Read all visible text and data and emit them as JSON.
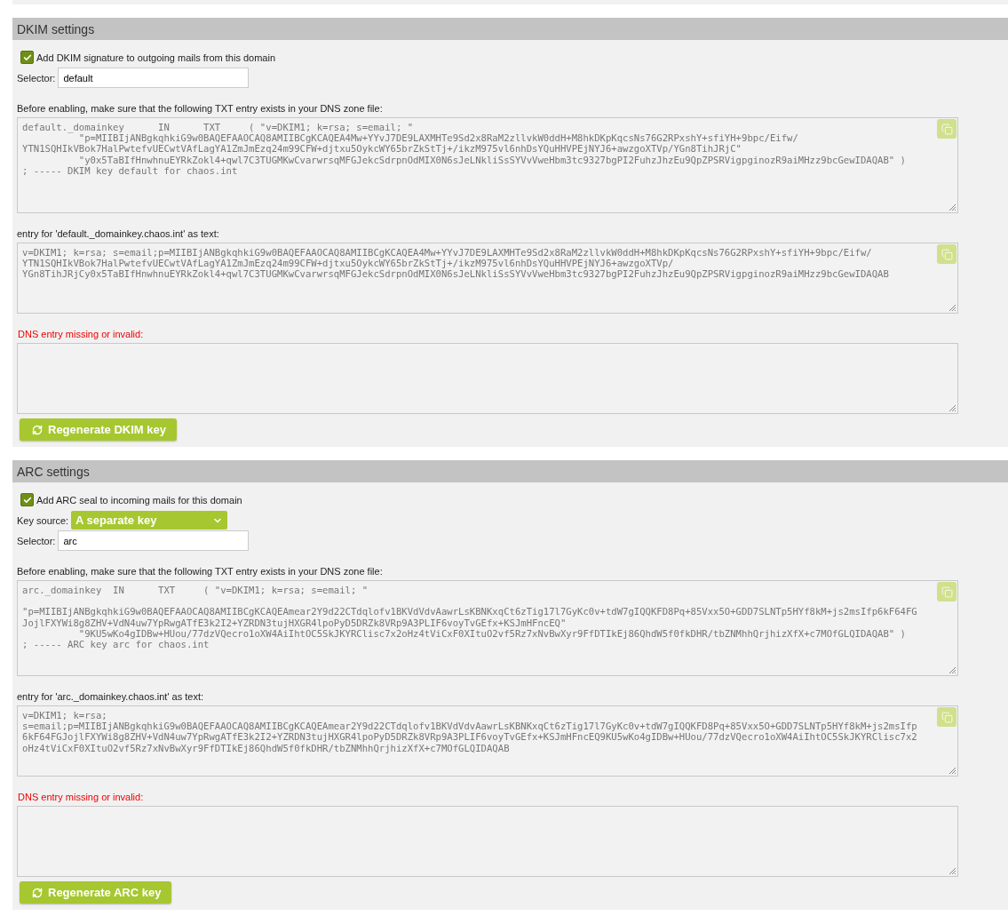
{
  "sections": [
    {
      "title": "DKIM settings",
      "fields": [
        {
          "kind": "checkbox",
          "label": "Add DKIM signature to outgoing mails from this domain",
          "checked": true
        },
        {
          "kind": "text",
          "label": "Selector:",
          "value": "default"
        }
      ],
      "blocks": [
        {
          "kind": "record",
          "label": "Before enabling, make sure that the following TXT entry exists in your DNS zone file:",
          "copy_button": true,
          "text": "default._domainkey      IN      TXT     ( \"v=DKIM1; k=rsa; s=email; \"\n          \"p=MIIBIjANBgkqhkiG9w0BAQEFAAOCAQ8AMIIBCgKCAQEA4Mw+YYvJ7DE9LAXMHTe9Sd2x8RaM2zllvkW0ddH+M8hkDKpKqcsNs76G2RPxshY+sfiYH+9bpc/Eifw/\nYTN1SQHIkVBok7HalPwtefvUECwtVAfLagYA1ZmJmEzq24m99CFW+djtxu5OykcWY65brZkStTj+/ikzM975vl6nhDsYQuHHVPEjNYJ6+awzgoXTVp/YGn8TihJRjC\"\n          \"y0x5TaBIfHnwhnuEYRkZokl4+qwl7C3TUGMKwCvarwrsqMFGJekcSdrpnOdMIX0N6sJeLNkliSsSYVvVweHbm3tc9327bgPI2FuhzJhzEu9QpZPSRVigpginozR9aiMHzz9bcGewIDAQAB\" )\n; ----- DKIM key default for chaos.int"
        },
        {
          "kind": "entry",
          "label": "entry for 'default._domainkey.chaos.int' as text:",
          "copy_button": true,
          "text": "v=DKIM1; k=rsa; s=email;p=MIIBIjANBgkqhkiG9w0BAQEFAAOCAQ8AMIIBCgKCAQEA4Mw+YYvJ7DE9LAXMHTe9Sd2x8RaM2zllvkW0ddH+M8hkDKpKqcsNs76G2RPxshY+sfiYH+9bpc/Eifw/\nYTN1SQHIkVBok7HalPwtefvUECwtVAfLagYA1ZmJmEzq24m99CFW+djtxu5OykcWY65brZkStTj+/ikzM975vl6nhDsYQuHHVPEjNYJ6+awzgoXTVp/\nYGn8TihJRjCy0x5TaBIfHnwhnuEYRkZokl4+qwl7C3TUGMKwCvarwrsqMFGJekcSdrpnOdMIX0N6sJeLNkliSsSYVvVweHbm3tc9327bgPI2FuhzJhzEu9QpZPSRVigpginozR9aiMHzz9bcGewIDAQAB"
        },
        {
          "kind": "error",
          "label": "DNS entry missing or invalid:",
          "copy_button": false
        }
      ],
      "button": "Regenerate DKIM key"
    },
    {
      "title": "ARC settings",
      "fields": [
        {
          "kind": "checkbox",
          "label": "Add ARC seal to incoming mails for this domain",
          "checked": true
        },
        {
          "kind": "select",
          "label": "Key source:",
          "value": "A separate key"
        },
        {
          "kind": "text",
          "label": "Selector:",
          "value": "arc"
        }
      ],
      "blocks": [
        {
          "kind": "record",
          "label": "Before enabling, make sure that the following TXT entry exists in your DNS zone file:",
          "copy_button": true,
          "text": "arc._domainkey  IN      TXT     ( \"v=DKIM1; k=rsa; s=email; \"\n\n\"p=MIIBIjANBgkqhkiG9w0BAQEFAAOCAQ8AMIIBCgKCAQEAmear2Y9d22CTdqlofv1BKVdVdvAawrLsKBNKxqCt6zTig17l7GyKc0v+tdW7gIQQKFD8Pq+85Vxx5O+GDD7SLNTp5HYf8kM+js2msIfp6kF64FG\nJojlFXYWi8g8ZHV+VdN4uw7YpRwgATfE3k2I2+YZRDN3tujHXGR4lpoPyD5DRZk8VRp9A3PLIF6voyTvGEfx+KSJmHFncEQ\"\n          \"9KU5wKo4gIDBw+HUou/77dzVQecro1oXW4AiIhtOC5SkJKYRClisc7x2oHz4tViCxF0XItuO2vf5Rz7xNvBwXyr9FfDTIkEj86QhdW5f0fkDHR/tbZNMhhQrjhizXfX+c7MOfGLQIDAQAB\" )\n; ----- ARC key arc for chaos.int"
        },
        {
          "kind": "entry",
          "label": "entry for 'arc._domainkey.chaos.int' as text:",
          "copy_button": true,
          "text": "v=DKIM1; k=rsa;\ns=email;p=MIIBIjANBgkqhkiG9w0BAQEFAAOCAQ8AMIIBCgKCAQEAmear2Y9d22CTdqlofv1BKVdVdvAawrLsKBNKxqCt6zTig17l7GyKc0v+tdW7gIQQKFD8Pq+85Vxx5O+GDD7SLNTp5HYf8kM+js2msIfp\n6kF64FGJojlFXYWi8g8ZHV+VdN4uw7YpRwgATfE3k2I2+YZRDN3tujHXGR4lpoPyD5DRZk8VRp9A3PLIF6voyTvGEfx+KSJmHFncEQ9KU5wKo4gIDBw+HUou/77dzVQecro1oXW4AiIhtOC5SkJKYRClisc7x2\noHz4tViCxF0XItuO2vf5Rz7xNvBwXyr9FfDTIkEj86QhdW5f0fkDHR/tbZNMhhQrjhizXfX+c7MOfGLQIDAQAB"
        },
        {
          "kind": "error",
          "label": "DNS entry missing or invalid:",
          "copy_button": false
        }
      ],
      "button": "Regenerate ARC key"
    }
  ]
}
